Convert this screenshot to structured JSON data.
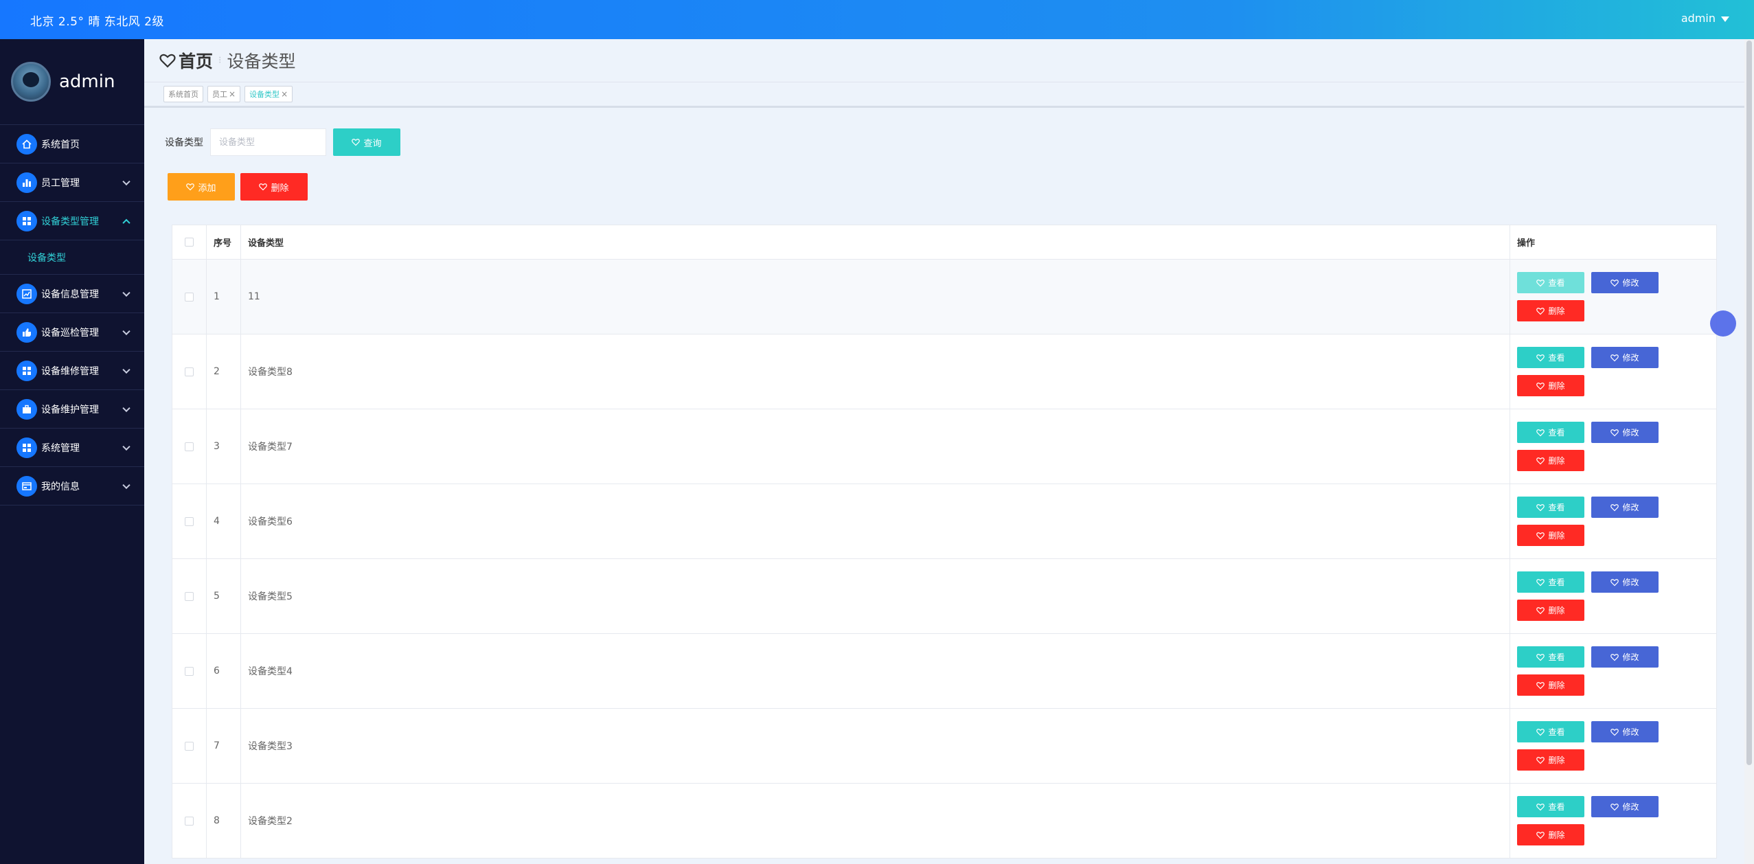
{
  "topbar": {
    "weather": "北京  2.5°  晴  东北风  2级",
    "user": "admin"
  },
  "sidebar": {
    "brand": "admin",
    "items": [
      {
        "label": "系统首页",
        "icon": "home-icon"
      },
      {
        "label": "员工管理",
        "icon": "bar-chart-icon"
      },
      {
        "label": "设备类型管理",
        "icon": "grid-icon",
        "active": true
      },
      {
        "label": "设备类型",
        "sub": true
      },
      {
        "label": "设备信息管理",
        "icon": "chart-icon"
      },
      {
        "label": "设备巡检管理",
        "icon": "thumb-icon"
      },
      {
        "label": "设备维修管理",
        "icon": "grid-icon"
      },
      {
        "label": "设备维护管理",
        "icon": "briefcase-icon"
      },
      {
        "label": "系统管理",
        "icon": "grid-icon"
      },
      {
        "label": "我的信息",
        "icon": "card-icon"
      }
    ]
  },
  "header": {
    "home": "首页",
    "current": "设备类型"
  },
  "tabs": [
    {
      "label": "系统首页"
    },
    {
      "label": "员工"
    },
    {
      "label": "设备类型",
      "active": true
    }
  ],
  "search": {
    "label": "设备类型",
    "placeholder": "设备类型",
    "query_label": "查询"
  },
  "actions": {
    "add_label": "添加",
    "delete_label": "删除"
  },
  "table": {
    "headers": [
      "序号",
      "设备类型",
      "操作"
    ],
    "rows": [
      {
        "no": "1",
        "type": "11"
      },
      {
        "no": "2",
        "type": "设备类型8"
      },
      {
        "no": "3",
        "type": "设备类型7"
      },
      {
        "no": "4",
        "type": "设备类型6"
      },
      {
        "no": "5",
        "type": "设备类型5"
      },
      {
        "no": "6",
        "type": "设备类型4"
      },
      {
        "no": "7",
        "type": "设备类型3"
      },
      {
        "no": "8",
        "type": "设备类型2"
      }
    ],
    "row_actions": {
      "view": "查看",
      "edit": "修改",
      "delete": "删除"
    }
  },
  "colors": {
    "accent_teal": "#2dcfc7",
    "edit_blue": "#4766d6",
    "danger_red": "#ff2a24",
    "warning_orange": "#ff9f1a",
    "sidebar_bg": "#0f1330"
  }
}
